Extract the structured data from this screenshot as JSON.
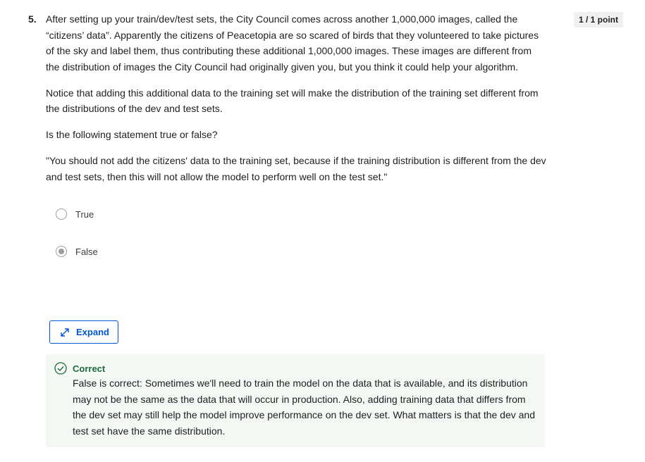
{
  "question": {
    "number": "5.",
    "points": "1 / 1 point",
    "paragraphs": [
      "After setting up your train/dev/test sets, the City Council comes across another 1,000,000 images, called the “citizens’ data”. Apparently the citizens of Peacetopia are so scared of birds that they volunteered to take pictures of the sky and label them, thus contributing these additional 1,000,000 images. These images are different from the distribution of images the City Council had originally given you, but you think it could help your algorithm.",
      "Notice that adding this additional data to the training set will make the distribution of the training set different from the distributions of the dev and test sets.",
      "Is the following statement true or false?",
      "\"You should not add the citizens' data to the training set, because if the training distribution is different from the dev and test sets, then this will not allow the model to perform well on the test set.\""
    ]
  },
  "options": [
    {
      "label": "True",
      "selected": false
    },
    {
      "label": "False",
      "selected": true
    }
  ],
  "expand_button": {
    "label": "Expand",
    "icon": "expand-arrows-icon",
    "color": "#0056d2"
  },
  "feedback": {
    "title": "Correct",
    "text": "False is correct: Sometimes we'll need to train the model on the data that is available, and its distribution may not be the same as the data that will occur in production. Also, adding training data that differs from the dev set may still help the model improve performance on the dev set. What matters is that the dev and test set have the same distribution.",
    "icon": "check-circle-icon",
    "color": "#1e6a3a",
    "background": "#f3f8f4"
  }
}
